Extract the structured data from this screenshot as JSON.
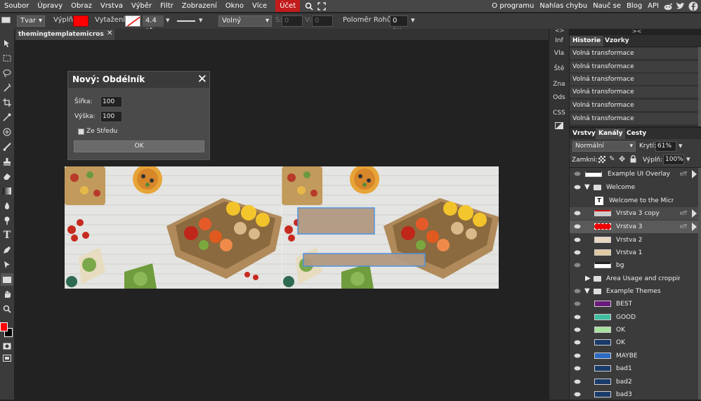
{
  "menu": [
    "Soubor",
    "Úpravy",
    "Obraz",
    "Vrstva",
    "Výběr",
    "Filtr",
    "Zobrazení",
    "Okno",
    "Více"
  ],
  "account_label": "Účet",
  "right_links": [
    "O programu",
    "Nahlas chybu",
    "Nauč se",
    "Blog",
    "API"
  ],
  "toolbar": {
    "shape_select": "Tvar",
    "fill_label": "Výplň:",
    "stroke_label": "Vytažení:",
    "stroke_width": "4.4 pt",
    "mode_select": "Volný",
    "w_label": "Š:",
    "w_value": "0",
    "h_label": "V:",
    "h_value": "0",
    "radius_label": "Poloměr Rohů:",
    "radius_value": "0 px"
  },
  "doc_tab": "themingtemplatemicros",
  "dialog": {
    "title": "Nový: Obdélník",
    "width_label": "Šířka:",
    "width_value": "100",
    "height_label": "Výška:",
    "height_value": "100",
    "center_label": "Ze Středu",
    "ok_label": "OK"
  },
  "side_tabs": [
    "Inf",
    "Vla",
    "Ště",
    "Zna",
    "Ods",
    "CSS"
  ],
  "history": {
    "tabs": [
      "Historie",
      "Vzorky"
    ],
    "items": [
      "Volná transformace",
      "Volná transformace",
      "Volná transformace",
      "Volná transformace",
      "Volná transformace",
      "Volná transformace"
    ]
  },
  "layers_panel": {
    "tabs": [
      "Vrstvy",
      "Kanály",
      "Cesty"
    ],
    "blend_mode": "Normální",
    "opacity_label": "Krytí:",
    "opacity_value": "61%",
    "lock_label": "Zamknì:",
    "fill_label": "Výplň:",
    "fill_value": "100%",
    "eff_label": "eff",
    "layers": [
      "Example UI Overlay",
      "Welcome",
      "Welcome to the Micr",
      "Vrstva 3 copy",
      "Vrstva 3",
      "Vrstva 2",
      "Vrstva 1",
      "bg",
      "Area Usage and croppin",
      "Example Themes",
      "BEST",
      "GOOD",
      "OK",
      "OK",
      "MAYBE",
      "bad1",
      "bad2",
      "bad3"
    ]
  },
  "colors": {
    "accent": "#c21b1b",
    "fill_color": "#ff0000",
    "selection_blue": "#4a90e2"
  }
}
